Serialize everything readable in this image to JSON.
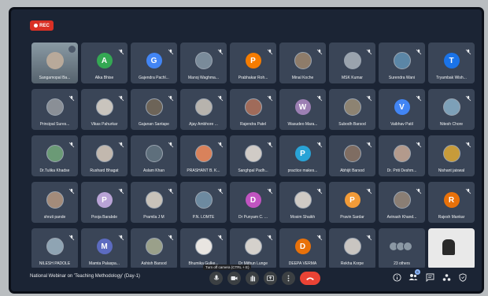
{
  "recording": {
    "label": "REC"
  },
  "participants": [
    {
      "name": "Sangamopal Ba...",
      "type": "selfview"
    },
    {
      "name": "Alka Bhise",
      "type": "letter",
      "initial": "A",
      "color": "#34a853"
    },
    {
      "name": "Gajendra Pachl...",
      "type": "letter",
      "initial": "G",
      "color": "#4285f4"
    },
    {
      "name": "Manoj Waghma...",
      "type": "photo",
      "color": "#7a8b9a"
    },
    {
      "name": "Prabhakar Roh...",
      "type": "letter",
      "initial": "P",
      "color": "#f57c00"
    },
    {
      "name": "Minal Koche",
      "type": "photo",
      "color": "#8e7c6a"
    },
    {
      "name": "MSK Kumar",
      "type": "photo",
      "color": "#9aa3ad"
    },
    {
      "name": "Surendra Wani",
      "type": "photo",
      "color": "#5b86a6"
    },
    {
      "name": "Tryambak Wish...",
      "type": "letter",
      "initial": "T",
      "color": "#1a73e8"
    },
    {
      "name": "Principal Sures...",
      "type": "photo",
      "color": "#8a8f96"
    },
    {
      "name": "Vikas Pahurkar",
      "type": "photo",
      "color": "#c9c4bd"
    },
    {
      "name": "Gajanan Santape",
      "type": "photo",
      "color": "#6d6458"
    },
    {
      "name": "Ajay Ambhore ...",
      "type": "photo",
      "color": "#b7b3ad"
    },
    {
      "name": "Rajendra Patel",
      "type": "photo",
      "color": "#a06b5a"
    },
    {
      "name": "Wasudeo Mara...",
      "type": "letter",
      "initial": "W",
      "color": "#9c7fb3"
    },
    {
      "name": "Subodh Barsod",
      "type": "photo",
      "color": "#8d8372"
    },
    {
      "name": "Vaibhav Patil",
      "type": "letter",
      "initial": "V",
      "color": "#4285f4"
    },
    {
      "name": "Nitesh Chore",
      "type": "photo",
      "color": "#7da0b8"
    },
    {
      "name": "Dr.Tulika Khadse",
      "type": "photo",
      "color": "#6b9a76"
    },
    {
      "name": "Rushard Bhagat",
      "type": "photo",
      "color": "#c2b8ae"
    },
    {
      "name": "Aslam Khan",
      "type": "photo",
      "color": "#5e6f7c"
    },
    {
      "name": "PRASHANT B. K...",
      "type": "photo",
      "color": "#d9825b"
    },
    {
      "name": "Sanghpal Padh...",
      "type": "photo",
      "color": "#d0cbc6"
    },
    {
      "name": "practice makes...",
      "type": "letter",
      "initial": "P",
      "color": "#29a3d6"
    },
    {
      "name": "Abhijit Barsod",
      "type": "photo",
      "color": "#7f6d62"
    },
    {
      "name": "Dr. Priti Deshm...",
      "type": "photo",
      "color": "#b39a8c"
    },
    {
      "name": "Nishant jaiswal",
      "type": "photo",
      "color": "#c79b3a"
    },
    {
      "name": "shruti pande",
      "type": "photo",
      "color": "#a38b7a"
    },
    {
      "name": "Pooja Barabde",
      "type": "letter",
      "initial": "P",
      "color": "#b9a3d6"
    },
    {
      "name": "Pramila J M",
      "type": "photo",
      "color": "#c8c2b9"
    },
    {
      "name": "P.N. LOMTE",
      "type": "photo",
      "color": "#6d8aa0"
    },
    {
      "name": "Dr Punyam C. ...",
      "type": "letter",
      "initial": "D",
      "color": "#c154c1"
    },
    {
      "name": "Mosim Shaikh",
      "type": "photo",
      "color": "#cfcac4"
    },
    {
      "name": "Pravin Sardar",
      "type": "letter",
      "initial": "P",
      "color": "#f29b38"
    },
    {
      "name": "Avinash Khand...",
      "type": "photo",
      "color": "#8a7e74"
    },
    {
      "name": "Rajesh Mankar",
      "type": "letter",
      "initial": "R",
      "color": "#e8710a"
    },
    {
      "name": "NILESH PADOLE",
      "type": "photo",
      "color": "#8fa4b3"
    },
    {
      "name": "Mamta Palaspa...",
      "type": "letter",
      "initial": "M",
      "color": "#5c6bc0"
    },
    {
      "name": "Ashish Barsod",
      "type": "photo",
      "color": "#9aa08a"
    },
    {
      "name": "Bhumika Gulke...",
      "type": "photo",
      "color": "#e9e5e1"
    },
    {
      "name": "Dr Mithun Lunge",
      "type": "photo",
      "color": "#d5d1cc"
    },
    {
      "name": "DEEPA VERMA",
      "type": "letter",
      "initial": "D",
      "color": "#e8710a"
    },
    {
      "name": "Rekha Korpe",
      "type": "photo",
      "color": "#c9c5c1"
    },
    {
      "name": "23 others",
      "type": "others"
    },
    {
      "name": "",
      "type": "presentation"
    }
  ],
  "bottom_bar": {
    "meeting_title": "National Webinar on 'Teaching Methodology' (Day-1)",
    "tooltip": "Turn off camera (CTRL + E)",
    "chat_badge": "6"
  },
  "colors": {
    "background": "#1b2434",
    "tile": "#3a4557",
    "end_call": "#ea4335",
    "record": "#d93025"
  }
}
